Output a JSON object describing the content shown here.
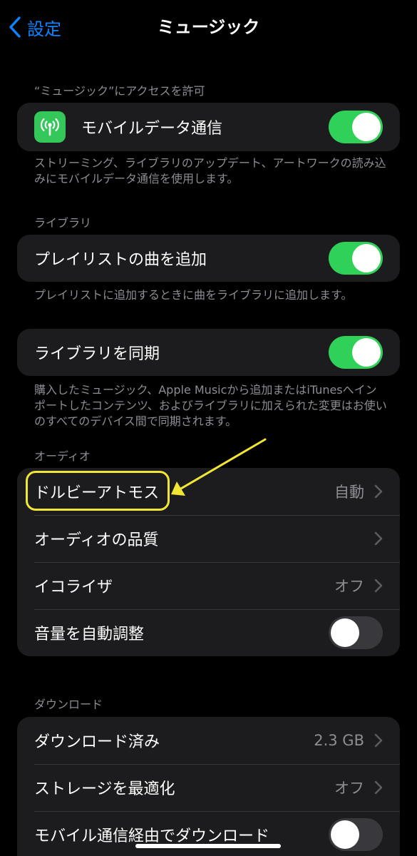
{
  "nav": {
    "back_label": "設定",
    "title": "ミュージック"
  },
  "access": {
    "header": "“ミュージック”にアクセスを許可",
    "cellular_label": "モバイルデータ通信",
    "cellular_on": true,
    "footer": "ストリーミング、ライブラリのアップデート、アートワークの読み込みにモバイルデータ通信を使用します。"
  },
  "library": {
    "header": "ライブラリ",
    "add_playlist_label": "プレイリストの曲を追加",
    "add_playlist_on": true,
    "add_playlist_footer": "プレイリストに追加するときに曲をライブラリに追加します。",
    "sync_label": "ライブラリを同期",
    "sync_on": true,
    "sync_footer": "購入したミュージック、Apple Musicから追加またはiTunesへインポートしたコンテンツ、およびライブラリに加えられた変更はお使いのすべてのデバイス間で同期されます。"
  },
  "audio": {
    "header": "オーディオ",
    "dolby_label": "ドルビーアトモス",
    "dolby_value": "自動",
    "quality_label": "オーディオの品質",
    "eq_label": "イコライザ",
    "eq_value": "オフ",
    "sound_check_label": "音量を自動調整",
    "sound_check_on": false
  },
  "downloads": {
    "header": "ダウンロード",
    "downloaded_label": "ダウンロード済み",
    "downloaded_value": "2.3 GB",
    "optimize_label": "ストレージを最適化",
    "optimize_value": "オフ",
    "cellular_download_label": "モバイル通信経由でダウンロード",
    "cellular_download_on": false
  },
  "colors": {
    "accent": "#0a84ff",
    "toggle_on": "#30d158",
    "toggle_off": "#39393d",
    "annotation": "#f2e634"
  }
}
